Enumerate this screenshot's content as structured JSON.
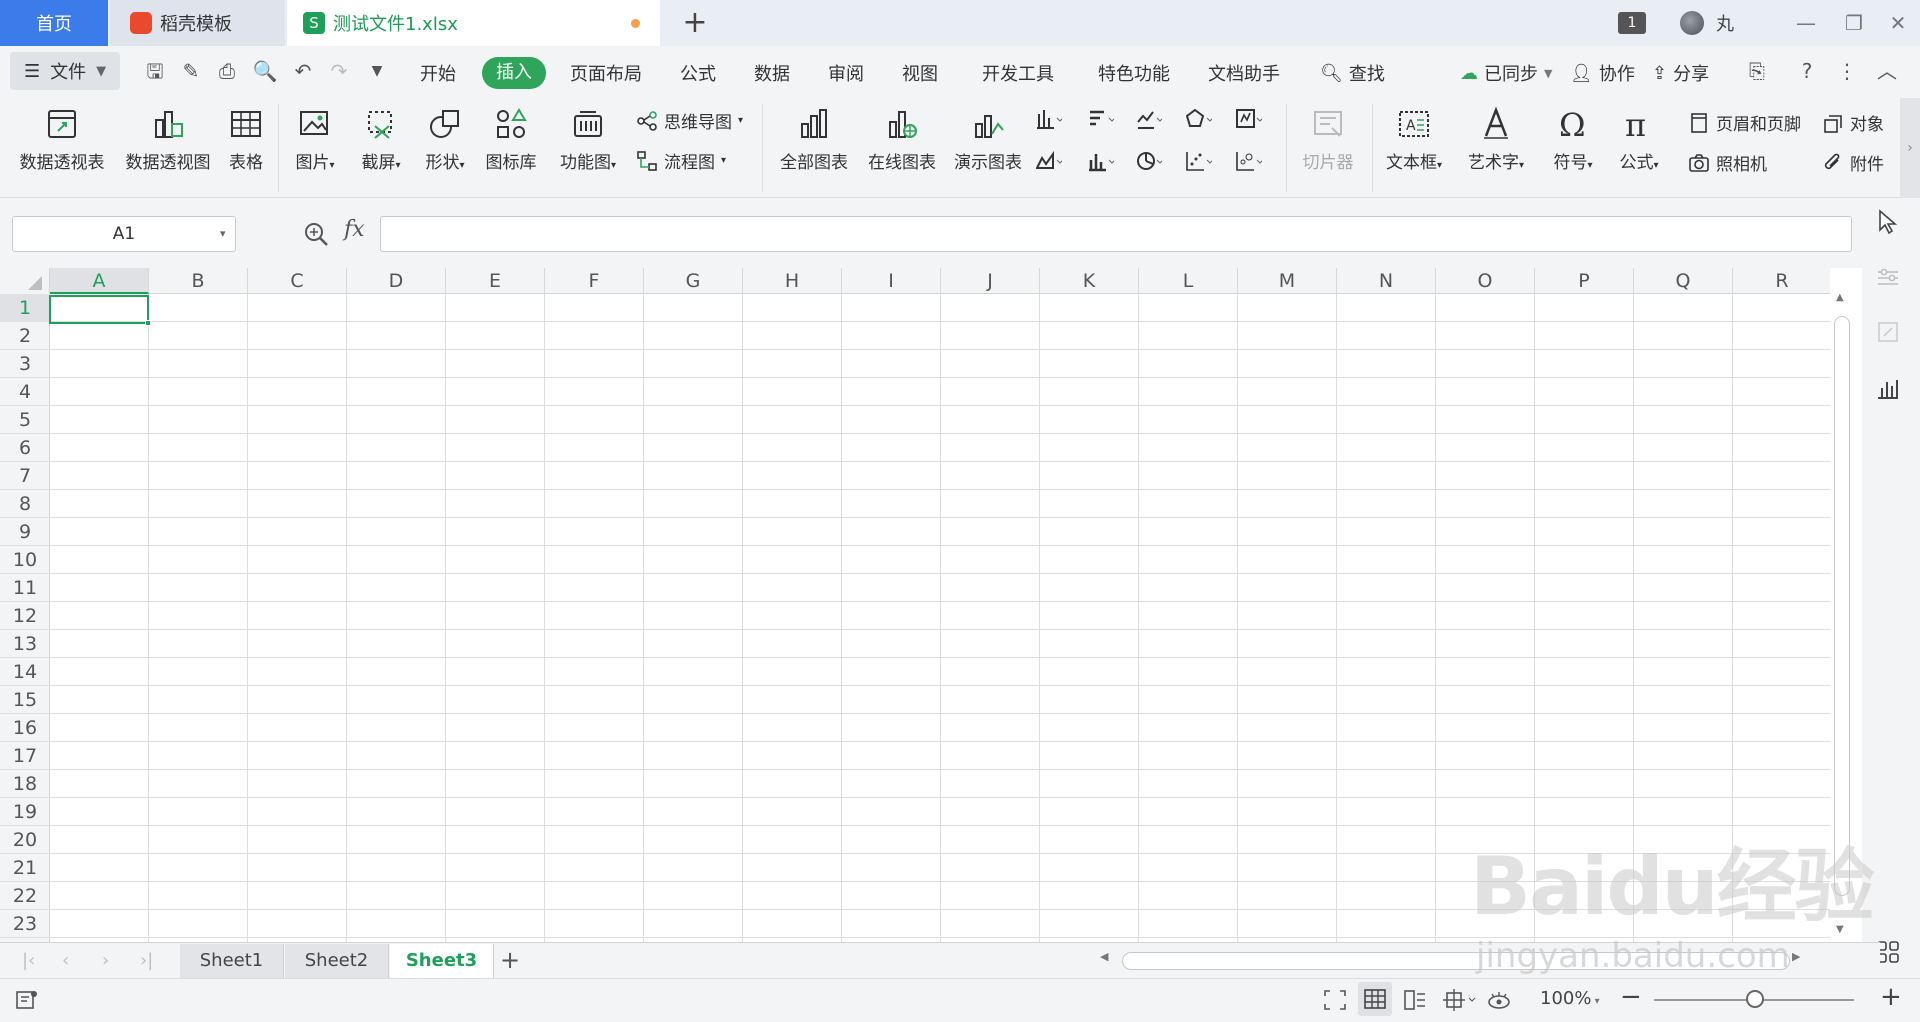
{
  "tabs": {
    "home": "首页",
    "docer": "稻壳模板",
    "file": "测试文件1.xlsx",
    "new_tab": "+"
  },
  "window": {
    "badge": "1",
    "user": "丸"
  },
  "menu": {
    "file": "文件",
    "items": [
      "开始",
      "插入",
      "页面布局",
      "公式",
      "数据",
      "审阅",
      "视图",
      "开发工具",
      "特色功能",
      "文档助手"
    ],
    "search": "查找",
    "synced": "已同步",
    "collab": "协作",
    "share": "分享"
  },
  "ribbon": {
    "pivot_table": "数据透视表",
    "pivot_chart": "数据透视图",
    "table": "表格",
    "picture": "图片",
    "screenshot": "截屏",
    "shape": "形状",
    "icon_lib": "图标库",
    "function_chart": "功能图",
    "mind_map": "思维导图",
    "flow_chart": "流程图",
    "all_charts": "全部图表",
    "online_charts": "在线图表",
    "demo_chart": "演示图表",
    "slicer": "切片器",
    "text_box": "文本框",
    "word_art": "艺术字",
    "symbol": "符号",
    "formula": "公式",
    "header_footer": "页眉和页脚",
    "object": "对象",
    "camera": "照相机",
    "attachment": "附件"
  },
  "formula_bar": {
    "name_box": "A1",
    "fx": "fx",
    "value": ""
  },
  "grid": {
    "columns": [
      "A",
      "B",
      "C",
      "D",
      "E",
      "F",
      "G",
      "H",
      "I",
      "J",
      "K",
      "L",
      "M",
      "N",
      "O",
      "P",
      "Q",
      "R"
    ],
    "rows": [
      "1",
      "2",
      "3",
      "4",
      "5",
      "6",
      "7",
      "8",
      "9",
      "10",
      "11",
      "12",
      "13",
      "14",
      "15",
      "16",
      "17",
      "18",
      "19",
      "20",
      "21",
      "22",
      "23"
    ],
    "active_cell": "A1"
  },
  "sheets": [
    "Sheet1",
    "Sheet2",
    "Sheet3"
  ],
  "active_sheet": "Sheet3",
  "status": {
    "zoom": "100%"
  },
  "watermark": {
    "logo": "Baidu经验",
    "url": "jingyan.baidu.com"
  },
  "colors": {
    "accent_green": "#1ea05a",
    "home_tab_blue": "#3b7cea",
    "insert_pill": "#2ea55a"
  }
}
